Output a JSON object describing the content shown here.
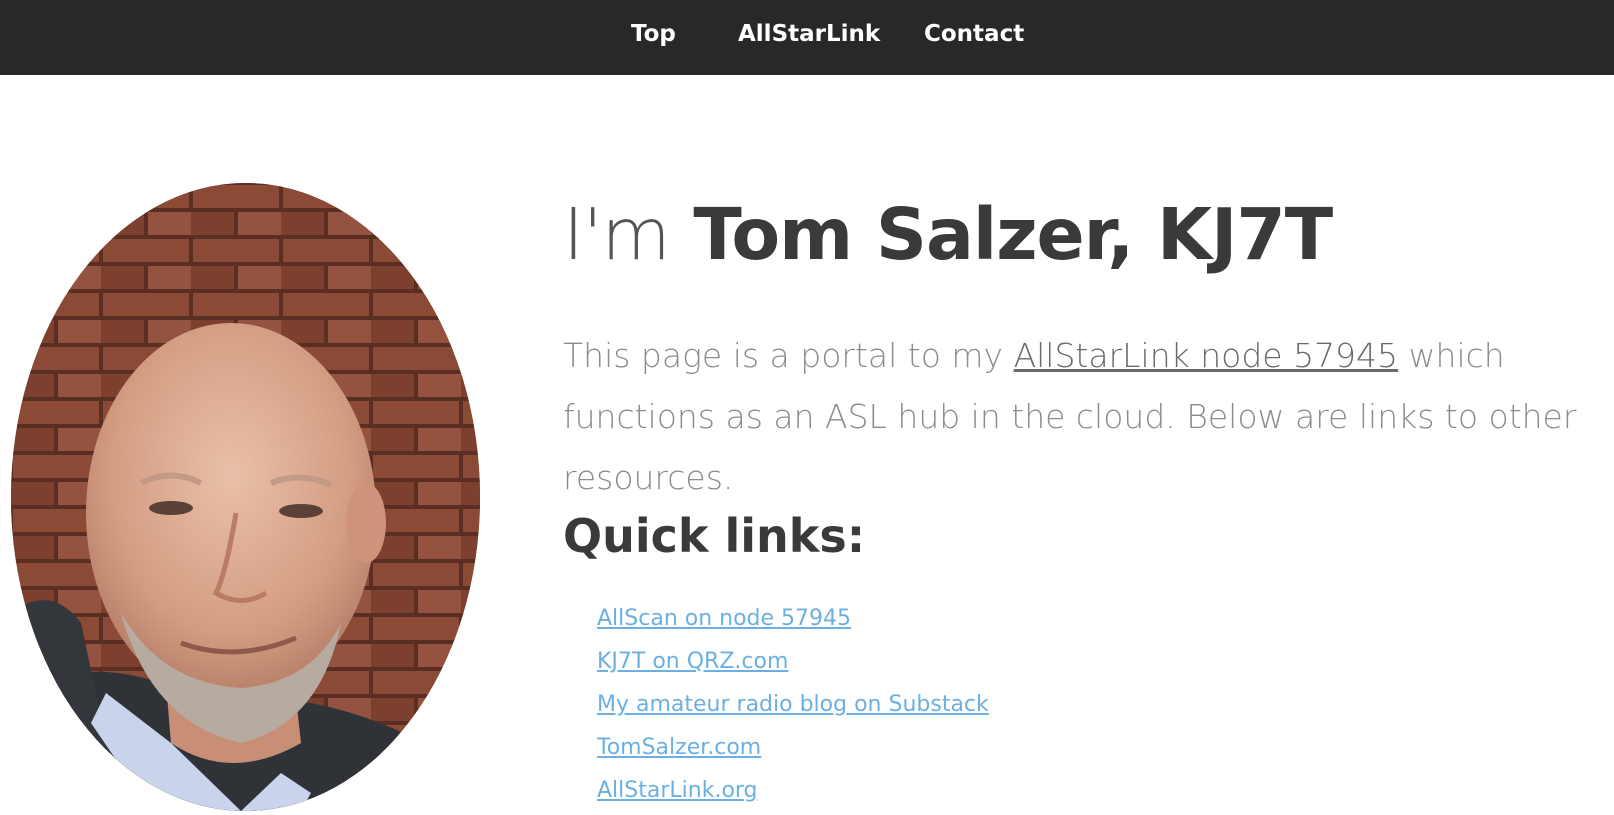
{
  "nav": {
    "items": [
      {
        "label": "Top"
      },
      {
        "label": "AllStarLink"
      },
      {
        "label": "Contact"
      }
    ]
  },
  "hero": {
    "headline_prefix": "I'm",
    "headline_name": "Tom Salzer, KJ7T",
    "intro_before": "This page is a portal to my ",
    "intro_link": "AllStarLink node 57945",
    "intro_after": " which functions as an ASL hub in the cloud. Below are links to other resources."
  },
  "quick_links": {
    "title": "Quick links:",
    "items": [
      {
        "label": "AllScan on node 57945"
      },
      {
        "label": "KJ7T on QRZ.com"
      },
      {
        "label": "My amateur radio blog on Substack"
      },
      {
        "label": "TomSalzer.com"
      },
      {
        "label": "AllStarLink.org"
      }
    ]
  },
  "colors": {
    "navbar_bg": "#282828",
    "heading": "#3a3a3a",
    "body_text": "#8c8c8c",
    "link": "#6cb0e2"
  }
}
